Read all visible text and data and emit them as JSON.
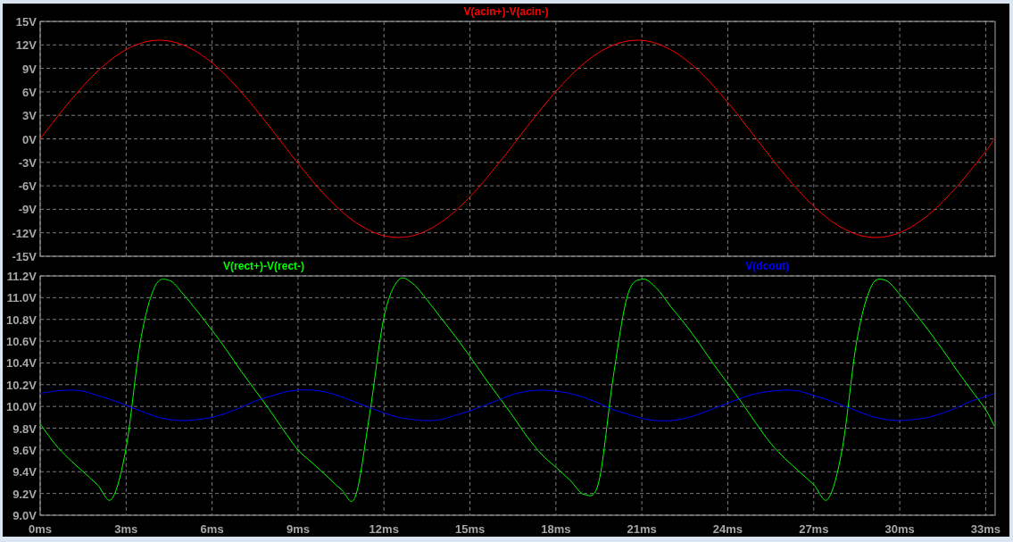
{
  "panes": [
    {
      "chart_data": {
        "type": "line",
        "grid": true,
        "x": [
          0,
          1,
          2,
          3,
          4,
          5,
          6,
          7,
          8,
          9,
          10,
          11,
          12,
          13,
          14,
          15,
          16,
          17,
          18,
          19,
          20,
          21,
          22,
          23,
          24,
          25,
          26,
          27,
          28,
          29,
          30,
          31,
          32,
          33,
          33.3
        ],
        "xlim": [
          0,
          33.33
        ],
        "ylim": [
          -15,
          15
        ],
        "yticks": [
          {
            "value": 15,
            "label": "15V"
          },
          {
            "value": 12,
            "label": "12V"
          },
          {
            "value": 9,
            "label": "9V"
          },
          {
            "value": 6,
            "label": "6V"
          },
          {
            "value": 3,
            "label": "3V"
          },
          {
            "value": 0,
            "label": "0V"
          },
          {
            "value": -3,
            "label": "-3V"
          },
          {
            "value": -6,
            "label": "-6V"
          },
          {
            "value": -9,
            "label": "-9V"
          },
          {
            "value": -12,
            "label": "-12V"
          },
          {
            "value": -15,
            "label": "-15V"
          }
        ],
        "series": [
          {
            "name": "V(acin+)-V(acin-)",
            "color": "#ff0000",
            "values": [
              0,
              4.64,
              8.63,
              11.4,
              12.58,
              11.98,
              9.71,
              6.07,
              1.58,
              -3.13,
              -7.41,
              -10.64,
              -12.38,
              -12.38,
              -10.64,
              -7.41,
              -3.13,
              1.58,
              6.07,
              9.71,
              11.98,
              12.58,
              11.4,
              8.63,
              4.64,
              0,
              -4.64,
              -8.63,
              -11.4,
              -12.58,
              -11.98,
              -9.71,
              -6.07,
              -1.58,
              0
            ]
          }
        ]
      }
    },
    {
      "chart_data": {
        "type": "line",
        "x": [
          0,
          0.5,
          1,
          1.5,
          2,
          2.5,
          3,
          3.5,
          4,
          4.5,
          5,
          5.5,
          6,
          6.5,
          7,
          7.5,
          8,
          8.5,
          9,
          9.5,
          10,
          10.5,
          11,
          11.5,
          12,
          12.5,
          13,
          13.5,
          14,
          14.5,
          15,
          15.5,
          16,
          16.5,
          17,
          17.5,
          18,
          18.5,
          19,
          19.5,
          20,
          20.5,
          21,
          21.5,
          22,
          22.5,
          23,
          23.5,
          24,
          24.5,
          25,
          25.5,
          26,
          26.5,
          27,
          27.5,
          28,
          28.5,
          29,
          29.5,
          30,
          30.5,
          31,
          31.5,
          32,
          32.5,
          33,
          33.3
        ],
        "grid": true,
        "xlim": [
          0,
          33.33
        ],
        "ylim": [
          9,
          11.2
        ],
        "xticks": [
          {
            "value": 0,
            "label": "0ms"
          },
          {
            "value": 3,
            "label": "3ms"
          },
          {
            "value": 6,
            "label": "6ms"
          },
          {
            "value": 9,
            "label": "9ms"
          },
          {
            "value": 12,
            "label": "12ms"
          },
          {
            "value": 15,
            "label": "15ms"
          },
          {
            "value": 18,
            "label": "18ms"
          },
          {
            "value": 21,
            "label": "21ms"
          },
          {
            "value": 24,
            "label": "24ms"
          },
          {
            "value": 27,
            "label": "27ms"
          },
          {
            "value": 30,
            "label": "30ms"
          },
          {
            "value": 33,
            "label": "33ms"
          }
        ],
        "yticks": [
          {
            "value": 11.2,
            "label": "11.2V"
          },
          {
            "value": 11,
            "label": "11.0V"
          },
          {
            "value": 10.8,
            "label": "10.8V"
          },
          {
            "value": 10.6,
            "label": "10.6V"
          },
          {
            "value": 10.4,
            "label": "10.4V"
          },
          {
            "value": 10.2,
            "label": "10.2V"
          },
          {
            "value": 10,
            "label": "10.0V"
          },
          {
            "value": 9.8,
            "label": "9.8V"
          },
          {
            "value": 9.6,
            "label": "9.6V"
          },
          {
            "value": 9.4,
            "label": "9.4V"
          },
          {
            "value": 9.2,
            "label": "9.2V"
          },
          {
            "value": 9,
            "label": "9.0V"
          }
        ],
        "series": [
          {
            "name": "V(rect+)-V(rect-)",
            "color": "#00ff00",
            "values": [
              9.84,
              9.66,
              9.52,
              9.4,
              9.28,
              9.15,
              9.62,
              10.6,
              11.1,
              11.16,
              11.03,
              10.87,
              10.7,
              10.52,
              10.33,
              10.15,
              9.97,
              9.78,
              9.6,
              9.48,
              9.36,
              9.24,
              9.17,
              9.93,
              10.82,
              11.16,
              11.13,
              10.98,
              10.81,
              10.64,
              10.46,
              10.27,
              10.09,
              9.91,
              9.72,
              9.56,
              9.44,
              9.32,
              9.19,
              9.31,
              10.27,
              11.02,
              11.17,
              11.09,
              10.92,
              10.76,
              10.58,
              10.39,
              10.21,
              10.03,
              9.84,
              9.66,
              9.52,
              9.4,
              9.28,
              9.15,
              9.62,
              10.6,
              11.1,
              11.16,
              11.03,
              10.87,
              10.7,
              10.52,
              10.33,
              10.15,
              9.97,
              9.82
            ]
          },
          {
            "name": "V(dcout)",
            "color": "#0000ff",
            "values": [
              10.12,
              10.14,
              10.15,
              10.14,
              10.1,
              10.06,
              10.01,
              9.96,
              9.91,
              9.88,
              9.87,
              9.88,
              9.9,
              9.94,
              9.99,
              10.05,
              10.09,
              10.13,
              10.15,
              10.15,
              10.13,
              10.09,
              10.04,
              9.99,
              9.94,
              9.9,
              9.88,
              9.87,
              9.88,
              9.92,
              9.96,
              10.01,
              10.06,
              10.11,
              10.14,
              10.15,
              10.14,
              10.12,
              10.08,
              10.03,
              9.97,
              9.93,
              9.89,
              9.87,
              9.87,
              9.89,
              9.93,
              9.98,
              10.03,
              10.08,
              10.12,
              10.14,
              10.15,
              10.14,
              10.1,
              10.06,
              10.01,
              9.96,
              9.91,
              9.88,
              9.87,
              9.88,
              9.9,
              9.94,
              9.99,
              10.05,
              10.09,
              10.12
            ]
          }
        ]
      }
    }
  ]
}
